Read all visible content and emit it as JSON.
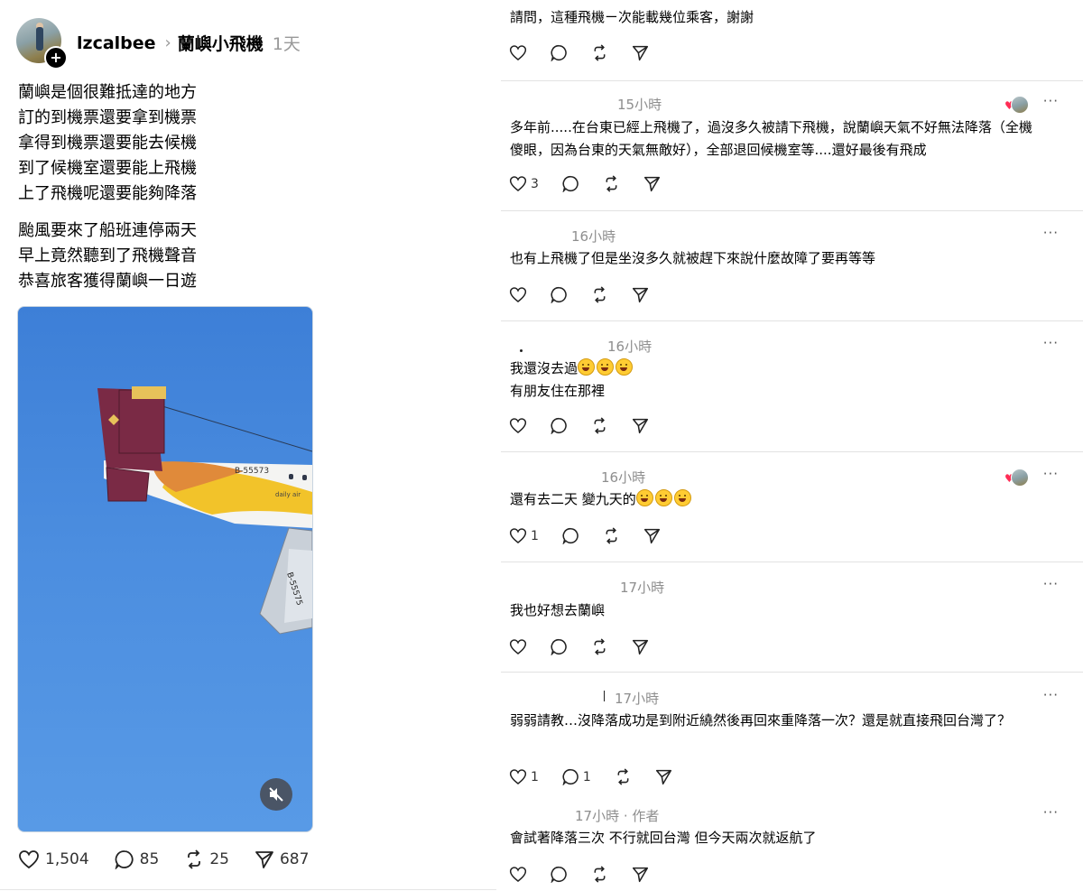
{
  "post": {
    "username": "lzcalbee",
    "topic": "蘭嶼小飛機",
    "time": "1天",
    "paragraph1": [
      "蘭嶼是個很難抵達的地方",
      "訂的到機票還要拿到機票",
      "拿得到機票還要能去候機",
      "到了候機室還要能上飛機",
      "上了飛機呢還要能夠降落"
    ],
    "paragraph2": [
      "颱風要來了船班連停兩天",
      "早上竟然聽到了飛機聲音",
      "恭喜旅客獲得蘭嶼一日遊"
    ],
    "media": {
      "aircraft_registration": "B-55573",
      "livery_text": "daily air",
      "wing_registration": "B-55575"
    },
    "stats": {
      "likes": "1,504",
      "replies": "85",
      "reposts": "25",
      "shares": "687"
    }
  },
  "comments": [
    {
      "time": "",
      "text": "請問，這種飛機ㄧ次能載幾位乘客，謝謝",
      "likes": "",
      "replies": ""
    },
    {
      "time": "15小時",
      "text": "多年前.....在台東已經上飛機了，過沒多久被請下飛機，說蘭嶼天氣不好無法降落（全機傻眼，因為台東的天氣無敵好），全部退回候機室等....還好最後有飛成",
      "likes": "3",
      "replies": ""
    },
    {
      "time": "16小時",
      "text": "也有上飛機了但是坐沒多久就被趕下來說什麼故障了要再等等",
      "likes": "",
      "replies": ""
    },
    {
      "time": "16小時",
      "text1": "我還沒去過",
      "text2": "有朋友住在那裡",
      "likes": "",
      "replies": ""
    },
    {
      "time": "16小時",
      "text": "還有去二天 變九天的",
      "likes": "1",
      "replies": ""
    },
    {
      "time": "17小時",
      "text": "我也好想去蘭嶼",
      "likes": "",
      "replies": ""
    },
    {
      "time": "17小時",
      "text": "弱弱請教…沒降落成功是到附近繞然後再回來重降落一次？還是就直接飛回台灣了？",
      "likes": "1",
      "replies": "1"
    },
    {
      "time": "17小時",
      "author_tag": "· 作者",
      "text": "會試著降落三次 不行就回台灣 但今天兩次就返航了",
      "likes": "",
      "replies": ""
    }
  ],
  "more_label": "···",
  "colors": {
    "heart": "#ff2d55",
    "sky": "#4b8ddf",
    "tail": "#7a2a45",
    "stripe": "#f2c32a"
  },
  "icons": {
    "like": "heart-icon",
    "reply": "speech-bubble-icon",
    "repost": "repost-icon",
    "share": "paper-plane-icon",
    "mute": "speaker-muted-icon",
    "more": "more-horizontal-icon"
  }
}
